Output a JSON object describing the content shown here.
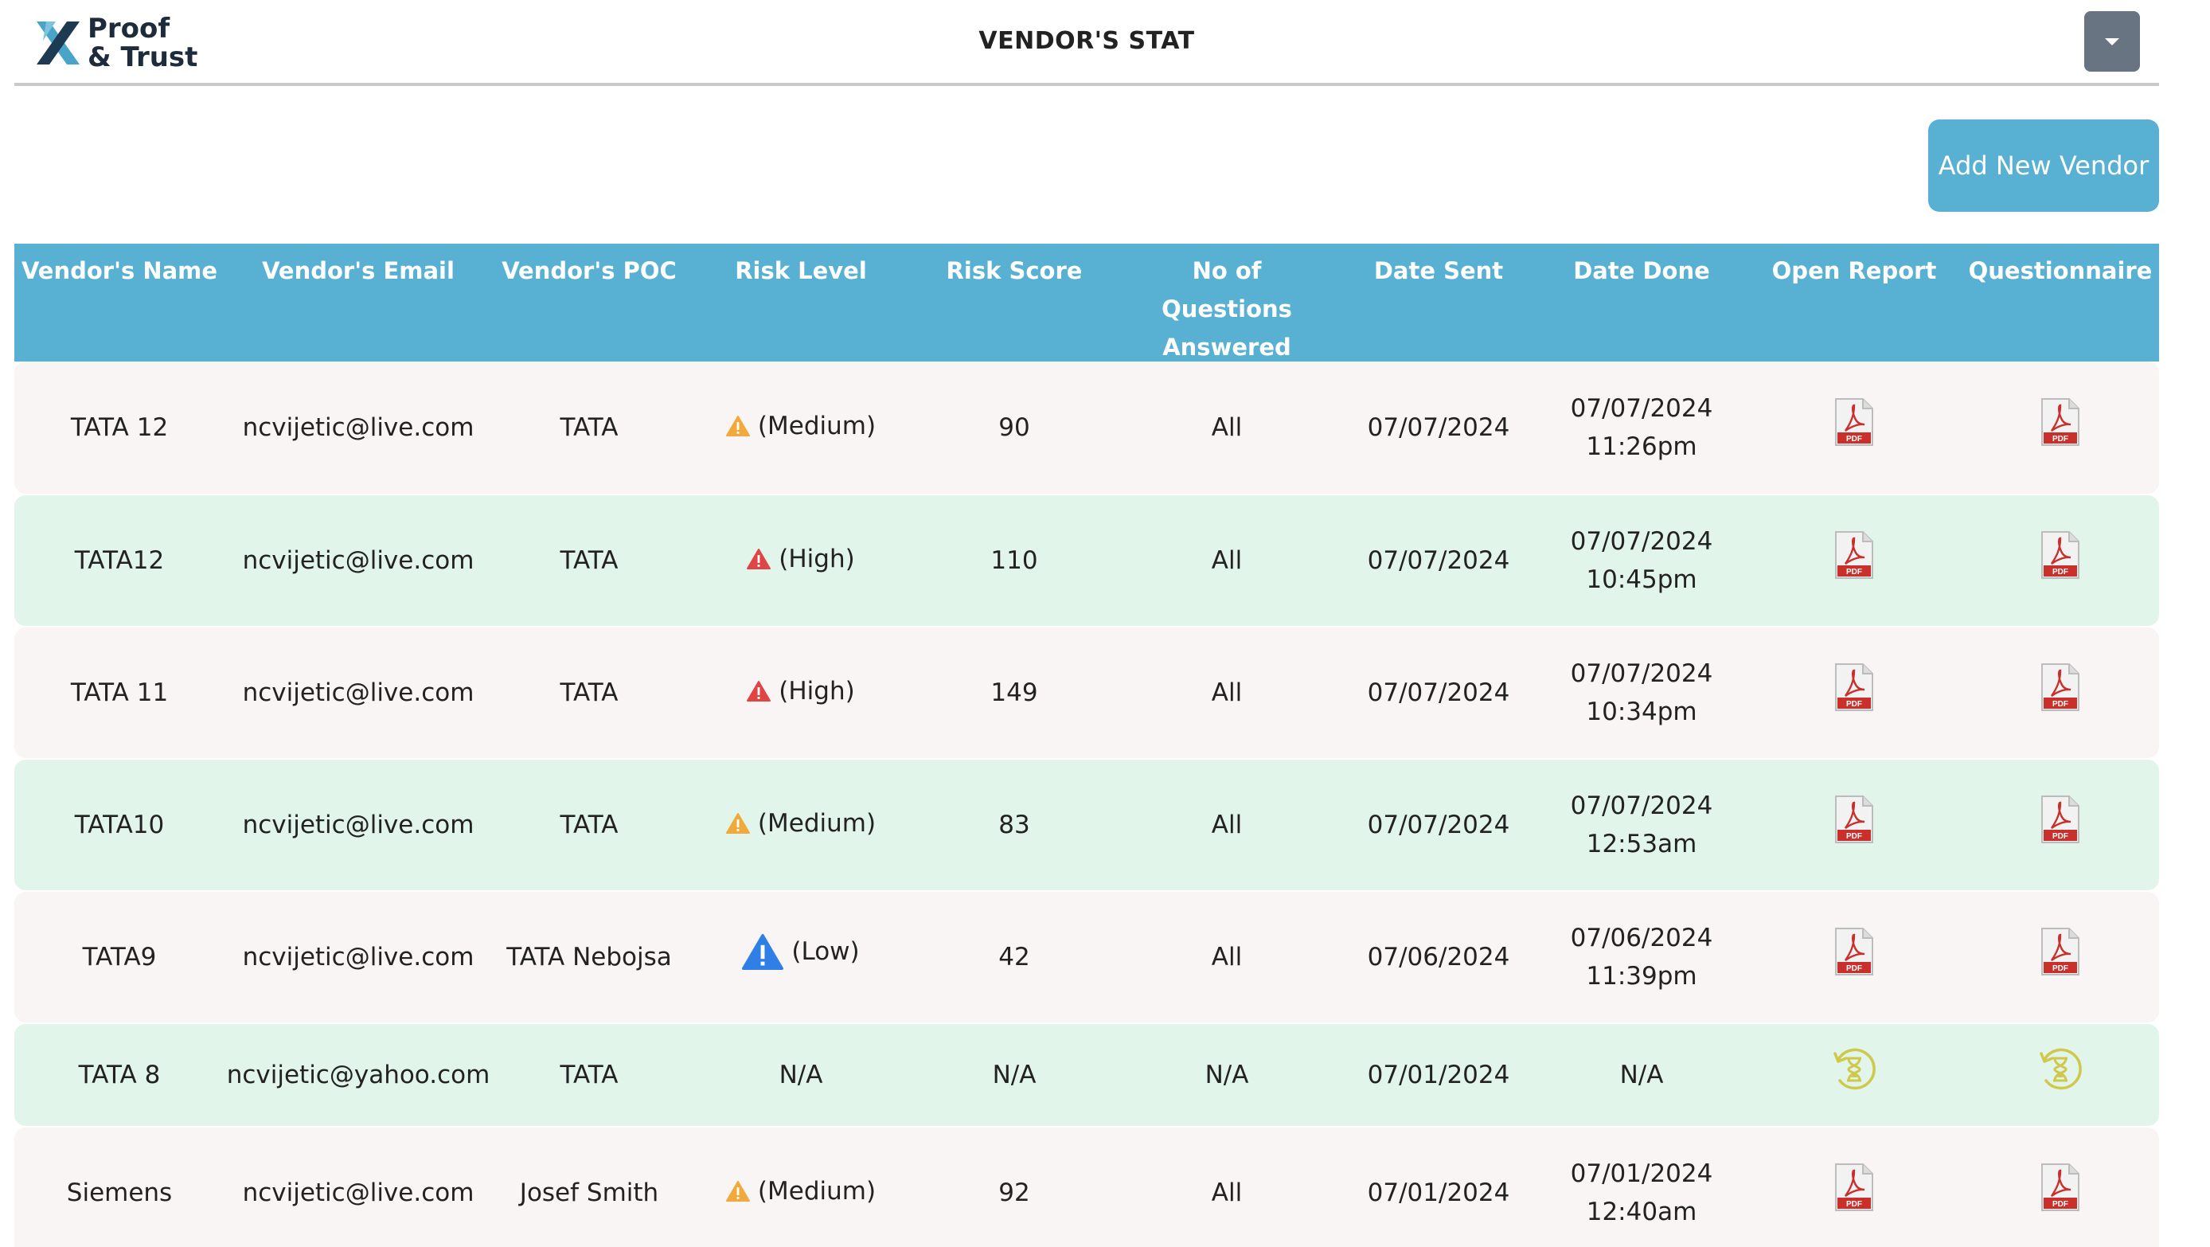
{
  "header": {
    "logo_line1": "Proof",
    "logo_line2": "& Trust",
    "title": "VENDOR'S STAT"
  },
  "actions": {
    "add_vendor_label": "Add New Vendor"
  },
  "table": {
    "columns": [
      "Vendor's Name",
      "Vendor's Email",
      "Vendor's POC",
      "Risk Level",
      "Risk Score",
      "No of Questions Answered",
      "Date Sent",
      "Date Done",
      "Open Report",
      "Questionnaire"
    ],
    "column_lines": {
      "answered_1": "No of",
      "answered_2": "Questions",
      "answered_3": "Answered"
    },
    "rows": [
      {
        "name": "TATA 12",
        "email": "ncvijetic@live.com",
        "poc": "TATA",
        "risk": "(Medium)",
        "risk_icon": "warning-icon-orange",
        "score": "90",
        "answered": "All",
        "sent": "07/07/2024",
        "done_date": "07/07/2024",
        "done_time": "11:26pm",
        "report_icon": "pdf-icon",
        "quest_icon": "pdf-icon"
      },
      {
        "name": "TATA12",
        "email": "ncvijetic@live.com",
        "poc": "TATA",
        "risk": "(High)",
        "risk_icon": "warning-icon-red",
        "score": "110",
        "answered": "All",
        "sent": "07/07/2024",
        "done_date": "07/07/2024",
        "done_time": "10:45pm",
        "report_icon": "pdf-icon",
        "quest_icon": "pdf-icon"
      },
      {
        "name": "TATA 11",
        "email": "ncvijetic@live.com",
        "poc": "TATA",
        "risk": "(High)",
        "risk_icon": "warning-icon-red",
        "score": "149",
        "answered": "All",
        "sent": "07/07/2024",
        "done_date": "07/07/2024",
        "done_time": "10:34pm",
        "report_icon": "pdf-icon",
        "quest_icon": "pdf-icon"
      },
      {
        "name": "TATA10",
        "email": "ncvijetic@live.com",
        "poc": "TATA",
        "risk": "(Medium)",
        "risk_icon": "warning-icon-orange",
        "score": "83",
        "answered": "All",
        "sent": "07/07/2024",
        "done_date": "07/07/2024",
        "done_time": "12:53am",
        "report_icon": "pdf-icon",
        "quest_icon": "pdf-icon"
      },
      {
        "name": "TATA9",
        "email": "ncvijetic@live.com",
        "poc": "TATA Nebojsa",
        "risk": "(Low)",
        "risk_icon": "warning-icon-blue",
        "score": "42",
        "answered": "All",
        "sent": "07/06/2024",
        "done_date": "07/06/2024",
        "done_time": "11:39pm",
        "report_icon": "pdf-icon",
        "quest_icon": "pdf-icon"
      },
      {
        "name": "TATA 8",
        "email": "ncvijetic@yahoo.com",
        "poc": "TATA",
        "risk": "N/A",
        "risk_icon": "",
        "score": "N/A",
        "answered": "N/A",
        "sent": "07/01/2024",
        "done_date": "N/A",
        "done_time": "",
        "report_icon": "hourglass-icon",
        "quest_icon": "hourglass-icon"
      },
      {
        "name": "Siemens",
        "email": "ncvijetic@live.com",
        "poc": "Josef Smith",
        "risk": "(Medium)",
        "risk_icon": "warning-icon-orange",
        "score": "92",
        "answered": "All",
        "sent": "07/01/2024",
        "done_date": "07/01/2024",
        "done_time": "12:40am",
        "report_icon": "pdf-icon",
        "quest_icon": "pdf-icon"
      }
    ]
  },
  "colors": {
    "header_bg": "#58b0d3",
    "row_odd": "#f9f5f4",
    "row_even": "#e1f5ea",
    "medium": "#f2a93b",
    "high": "#e04545",
    "low": "#2f7fe6",
    "pdf": "#c9302c",
    "pending": "#cfc84a"
  }
}
